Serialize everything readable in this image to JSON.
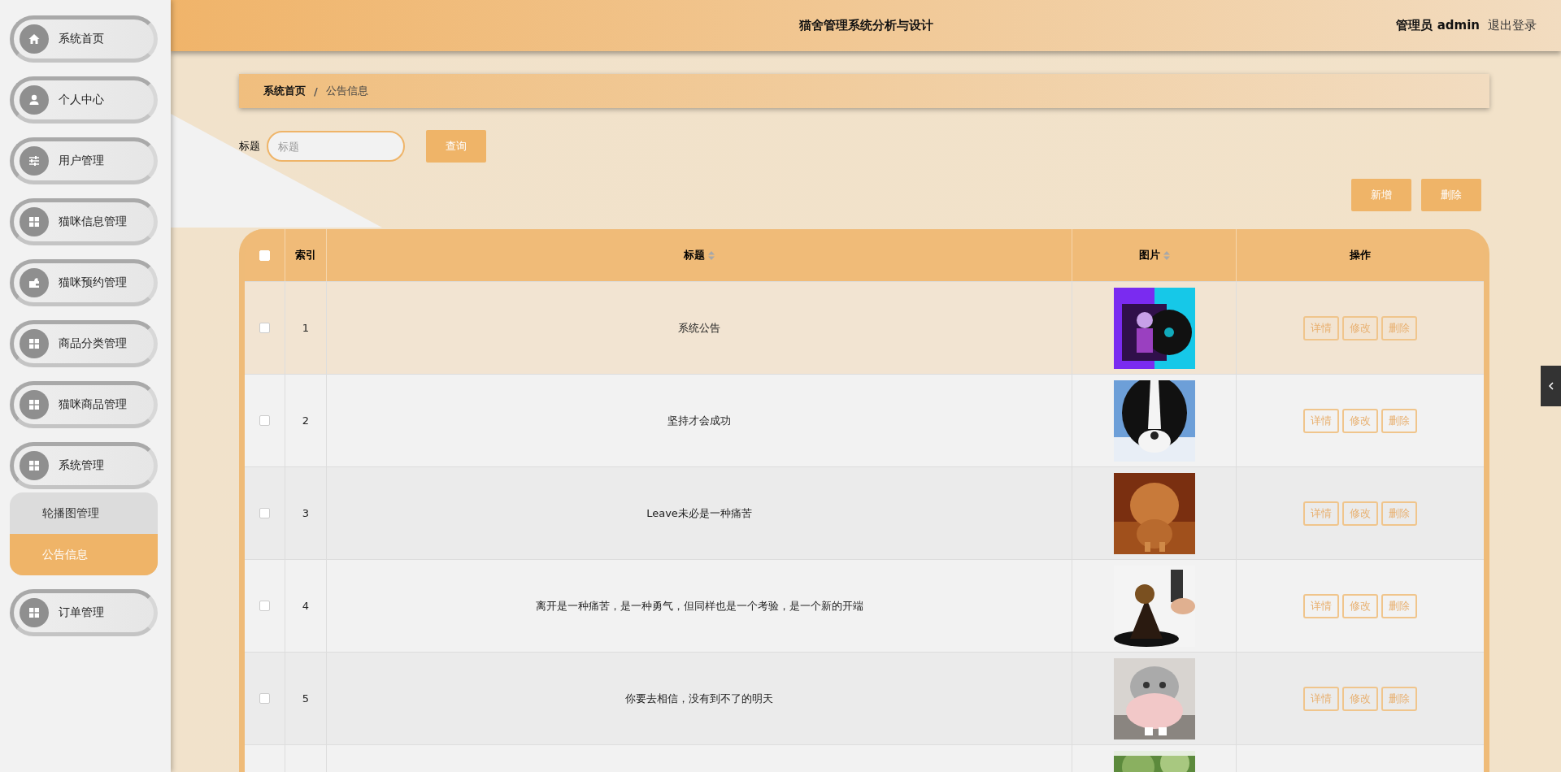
{
  "sidebar": {
    "items": [
      {
        "label": "系统首页",
        "selected": false
      },
      {
        "label": "个人中心",
        "selected": false
      },
      {
        "label": "用户管理",
        "selected": false
      },
      {
        "label": "猫咪信息管理",
        "selected": false
      },
      {
        "label": "猫咪预约管理",
        "selected": false
      },
      {
        "label": "商品分类管理",
        "selected": false
      },
      {
        "label": "猫咪商品管理",
        "selected": false
      },
      {
        "label": "系统管理",
        "selected": false,
        "expanded": true,
        "children": [
          {
            "label": "轮播图管理",
            "selected": false
          },
          {
            "label": "公告信息",
            "selected": true
          }
        ]
      },
      {
        "label": "订单管理",
        "selected": false
      }
    ]
  },
  "header": {
    "title": "猫舍管理系统分析与设计",
    "user": "管理员 admin",
    "logout": "退出登录"
  },
  "breadcrumb": {
    "separator": "/",
    "items": [
      "系统首页",
      "公告信息"
    ]
  },
  "search": {
    "label": "标题",
    "placeholder": "标题",
    "button": "查询"
  },
  "actions": [
    "新增",
    "删除"
  ],
  "table": {
    "select_all_checked": false,
    "columns": [
      {
        "label": "索引",
        "sortable": false
      },
      {
        "label": "标题",
        "sortable": true
      },
      {
        "label": "图片",
        "sortable": true
      },
      {
        "label": "操作",
        "sortable": false
      }
    ],
    "rows": [
      {
        "index": "1",
        "title": "系统公告",
        "checked": false,
        "highlighted": true,
        "buttons": [
          "详情",
          "修改",
          "删除"
        ]
      },
      {
        "index": "2",
        "title": "坚持才会成功",
        "checked": false,
        "highlighted": false,
        "buttons": [
          "详情",
          "修改",
          "删除"
        ]
      },
      {
        "index": "3",
        "title": "Leave未必是一种痛苦",
        "checked": false,
        "highlighted": false,
        "buttons": [
          "详情",
          "修改",
          "删除"
        ]
      },
      {
        "index": "4",
        "title": "离开是一种痛苦，是一种勇气，但同样也是一个考验，是一个新的开端",
        "checked": false,
        "highlighted": false,
        "buttons": [
          "详情",
          "修改",
          "删除"
        ]
      },
      {
        "index": "5",
        "title": "你要去相信，没有到不了的明天",
        "checked": false,
        "highlighted": false,
        "buttons": [
          "详情",
          "修改",
          "删除"
        ]
      },
      {
        "highlighted": false
      }
    ]
  }
}
